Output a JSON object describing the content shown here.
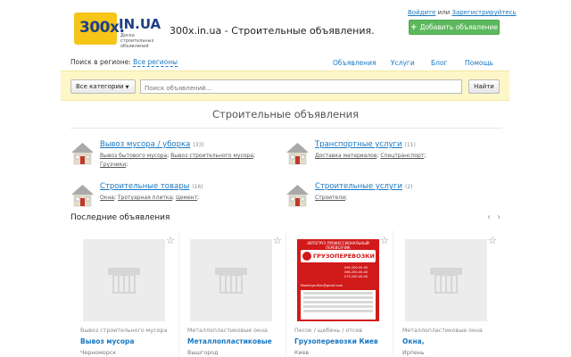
{
  "header": {
    "logo_main": "300x.",
    "logo_suffix": "IN.UA",
    "logo_tagline": "Доска строительных объявлений",
    "site_title": "300x.in.ua - Строительные объявления.",
    "login_label": "Войдите",
    "or_label": " или ",
    "register_label": "Зарегистрируйтесь",
    "add_button_label": "Добавить объявление"
  },
  "region": {
    "label": "Поиск в регионе:",
    "value": "Все регионы"
  },
  "nav": {
    "items": [
      "Объявления",
      "Услуги",
      "Блог",
      "Помощь"
    ]
  },
  "search": {
    "category_label": "Все категории",
    "placeholder": "Поиск объявлений...",
    "button_label": "Найти"
  },
  "section_title": "Строительные объявления",
  "categories": [
    {
      "title": "Вывоз мусора / уборка",
      "count": "(33)",
      "subs": [
        "Вывоз бытового мусора",
        "Вывоз строительного мусора",
        "Грузчики"
      ]
    },
    {
      "title": "Транспортные услуги",
      "count": "(11)",
      "subs": [
        "Доставка материалов",
        "Спецтранспорт"
      ]
    },
    {
      "title": "Строительные товары",
      "count": "(16)",
      "subs": [
        "Окна",
        "Тротуарная плитка",
        "Цемент"
      ]
    },
    {
      "title": "Строительные услуги",
      "count": "(2)",
      "subs": [
        "Строители"
      ]
    }
  ],
  "latest": {
    "title": "Последние объявления",
    "arrows": "‹ ›"
  },
  "listings": [
    {
      "category": "Вывоз строительного мусора",
      "name": "Вывоз мусора",
      "city": "Черноморск"
    },
    {
      "category": "Металлопластиковые окна",
      "name": "Металлопластиковые",
      "city": "Вышгород"
    },
    {
      "category": "Песок / щебень / отсев",
      "name": "Грузоперевозки Киев",
      "city": "Киев"
    },
    {
      "category": "Металлопластиковые окна",
      "name": "Окна,",
      "city": "Ирпень"
    }
  ],
  "ad_image": {
    "top_text": "АВТОГРУЗ ПРОФЕССИОНАЛЬНЫЙ ПЕРЕВОЗЧИК",
    "headline": "ГРУЗОПЕРЕВОЗКИ",
    "phones": [
      "099-200-00-00",
      "068-200-00-00",
      "073-200-00-00"
    ],
    "email": "Mashinga.Kiev@gmail.com"
  },
  "colors": {
    "link": "#1a78c2",
    "add_button": "#5cb85c",
    "search_band": "#fdf6c7",
    "logo_yellow": "#f5c518",
    "logo_blue": "#1e3f86",
    "ad_red": "#d11a1a"
  },
  "icons": {
    "category": "house-icon",
    "favorite": "star-outline-icon",
    "placeholder": "no-image-icon",
    "add": "plus-icon"
  }
}
